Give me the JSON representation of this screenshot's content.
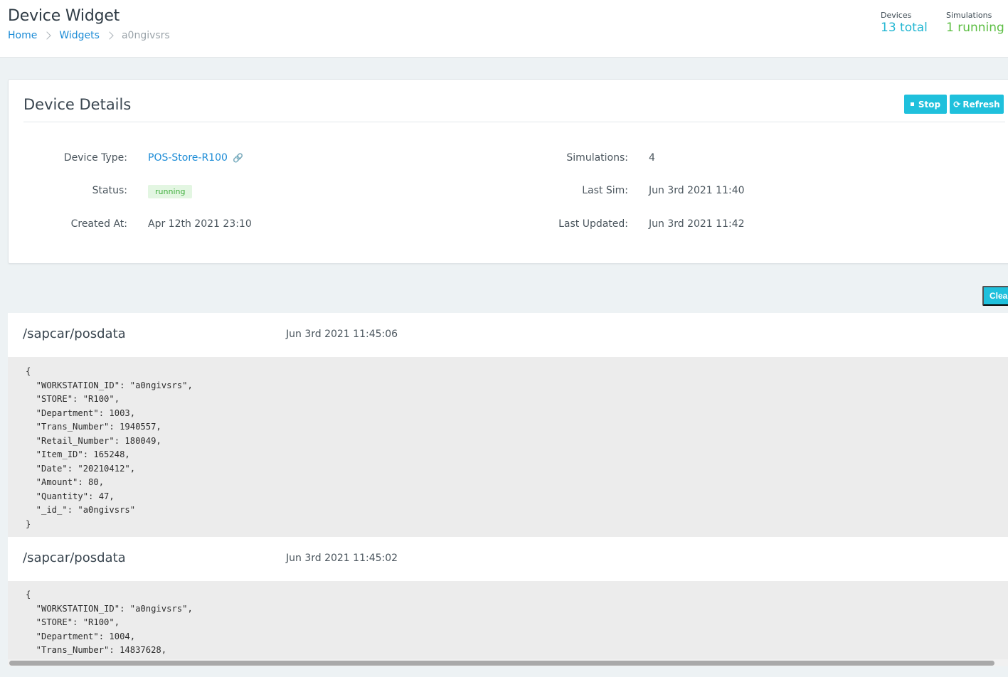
{
  "header": {
    "title": "Device Widget",
    "breadcrumb": {
      "home": "Home",
      "widgets": "Widgets",
      "current": "a0ngivsrs"
    },
    "stats": {
      "devices_label": "Devices",
      "devices_value": "13 total",
      "simulations_label": "Simulations",
      "simulations_value": "1 running"
    }
  },
  "details": {
    "title": "Device Details",
    "stop_label": "Stop",
    "refresh_label": "Refresh",
    "device_type_label": "Device Type:",
    "device_type_value": "POS-Store-R100",
    "status_label": "Status:",
    "status_value": "running",
    "created_label": "Created At:",
    "created_value": "Apr 12th 2021 23:10",
    "simulations_label": "Simulations:",
    "simulations_value": "4",
    "last_sim_label": "Last Sim:",
    "last_sim_value": "Jun 3rd 2021 11:40",
    "last_updated_label": "Last Updated:",
    "last_updated_value": "Jun 3rd 2021 11:42"
  },
  "clear_label": "Clear",
  "messages": [
    {
      "topic": "/sapcar/posdata",
      "time": "Jun 3rd 2021 11:45:06",
      "payload": "{\n  \"WORKSTATION_ID\": \"a0ngivsrs\",\n  \"STORE\": \"R100\",\n  \"Department\": 1003,\n  \"Trans_Number\": 1940557,\n  \"Retail_Number\": 180049,\n  \"Item_ID\": 165248,\n  \"Date\": \"20210412\",\n  \"Amount\": 80,\n  \"Quantity\": 47,\n  \"_id_\": \"a0ngivsrs\"\n}"
    },
    {
      "topic": "/sapcar/posdata",
      "time": "Jun 3rd 2021 11:45:02",
      "payload": "{\n  \"WORKSTATION_ID\": \"a0ngivsrs\",\n  \"STORE\": \"R100\",\n  \"Department\": 1004,\n  \"Trans_Number\": 14837628,"
    }
  ],
  "colors": {
    "accent": "#1fc0dc",
    "link": "#1b8bd6",
    "devices_stat": "#22b6d2",
    "running_stat": "#5cbe43",
    "badge_bg": "#e3f6e2",
    "badge_text": "#3fae3c"
  },
  "icons": {
    "stop": "stop-square-icon",
    "refresh": "refresh-icon",
    "external_link": "link-icon",
    "breadcrumb_separator": "chevron-right-icon"
  }
}
